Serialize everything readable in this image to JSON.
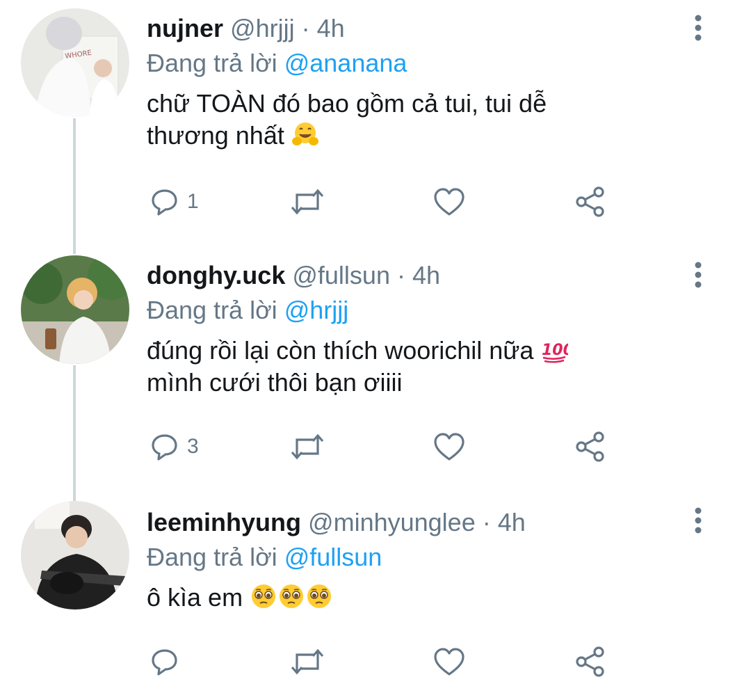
{
  "reply_prefix": "Đang trả lời",
  "tweets": [
    {
      "name": "nujner",
      "handle": "@hrjjj",
      "separator": "·",
      "time": "4h",
      "reply_to": "@ananana",
      "text_line1": "chữ TOÀN đó bao gồm cả tui, tui dễ",
      "text_line2": "thương nhất",
      "emoji": "hugging-face-emoji",
      "reply_count": "1",
      "avatar_text": "WHORE"
    },
    {
      "name": "donghy.uck",
      "handle": "@fullsun",
      "separator": "·",
      "time": "4h",
      "reply_to": "@hrjjj",
      "text_line1": "đúng rồi lại còn thích woorichil nữa",
      "text_line2": "mình cưới thôi bạn ơiiii",
      "emoji": "hundred-points-emoji",
      "reply_count": "3"
    },
    {
      "name": "leeminhyung",
      "handle": "@minhyunglee",
      "separator": "·",
      "time": "4h",
      "reply_to": "@fullsun",
      "text_line1": "ô kìa em",
      "emoji": "pleading-face-emoji",
      "reply_count": ""
    }
  ],
  "icons": [
    "reply-icon",
    "retweet-icon",
    "like-icon",
    "share-icon",
    "more-options-icon"
  ],
  "colors": {
    "accent": "#1da1f2",
    "secondary": "#657786",
    "icon": "#657786",
    "thread": "#ccd6dd"
  }
}
